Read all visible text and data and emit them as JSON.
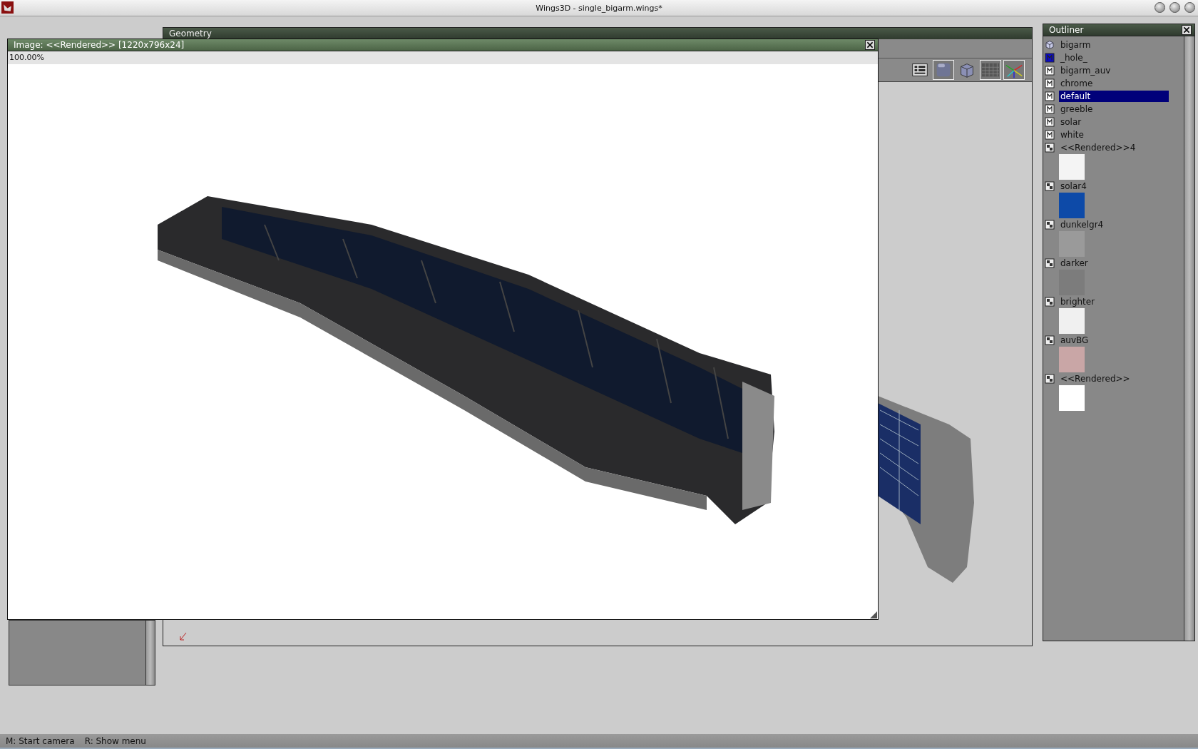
{
  "window": {
    "title": "Wings3D - single_bigarm.wings*"
  },
  "geometry_window": {
    "title": "Geometry",
    "toolbar": [
      {
        "kind": "view-settings",
        "selected": false
      },
      {
        "kind": "smooth-cube",
        "selected": true
      },
      {
        "kind": "flat-cube",
        "selected": false
      },
      {
        "kind": "ground-grid",
        "selected": true
      },
      {
        "kind": "axes",
        "selected": true
      }
    ]
  },
  "image_window": {
    "title": "Image: <<Rendered>> [1220x796x24]",
    "zoom": "100.00%"
  },
  "outliner": {
    "title": "Outliner",
    "items": [
      {
        "name": "bigarm",
        "kind": "object",
        "selected": false
      },
      {
        "name": "_hole_",
        "kind": "material",
        "color": "#0a0ac8",
        "selected": false
      },
      {
        "name": "bigarm_auv",
        "kind": "material",
        "color": "#ffffff",
        "selected": false
      },
      {
        "name": "chrome",
        "kind": "material",
        "color": "#ffffff",
        "selected": false
      },
      {
        "name": "default",
        "kind": "material",
        "color": "#ffffff",
        "selected": true
      },
      {
        "name": "greeble",
        "kind": "material",
        "color": "#ffffff",
        "selected": false
      },
      {
        "name": "solar",
        "kind": "material",
        "color": "#ffffff",
        "selected": false
      },
      {
        "name": "white",
        "kind": "material",
        "color": "#ffffff",
        "selected": false
      },
      {
        "name": "<<Rendered>>4",
        "kind": "image",
        "color": "#f4f4f4",
        "selected": false
      },
      {
        "name": "solar4",
        "kind": "image",
        "color": "#0d4aa8",
        "selected": false
      },
      {
        "name": "dunkelgr4",
        "kind": "image",
        "color": "#9a9a9a",
        "selected": false
      },
      {
        "name": "darker",
        "kind": "image",
        "color": "#7c7c7c",
        "selected": false
      },
      {
        "name": "brighter",
        "kind": "image",
        "color": "#f0f0f0",
        "selected": false
      },
      {
        "name": "auvBG",
        "kind": "image",
        "color": "#c9a6a6",
        "selected": false
      },
      {
        "name": "<<Rendered>>",
        "kind": "image",
        "color": "#ffffff",
        "selected": false
      }
    ]
  },
  "status_bar": [
    "M: Start camera",
    "R: Show menu"
  ]
}
